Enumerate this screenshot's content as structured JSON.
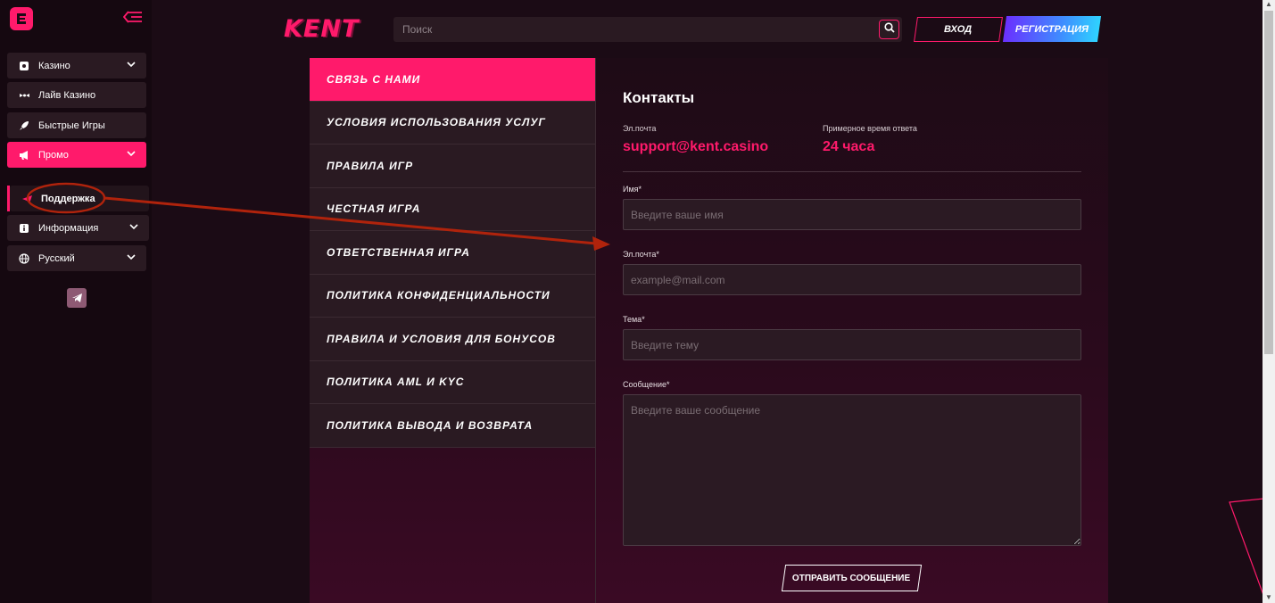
{
  "sidebar": {
    "items": [
      {
        "label": "Казино",
        "icon": "casino-icon",
        "expandable": true
      },
      {
        "label": "Лайв Казино",
        "icon": "live-casino-icon",
        "expandable": false
      },
      {
        "label": "Быстрые Игры",
        "icon": "rocket-icon",
        "expandable": false
      },
      {
        "label": "Промо",
        "icon": "megaphone-icon",
        "expandable": true,
        "active": true
      },
      {
        "label": "Поддержка",
        "icon": "support-icon",
        "expandable": false,
        "current": true
      },
      {
        "label": "Информация",
        "icon": "info-icon",
        "expandable": true
      },
      {
        "label": "Русский",
        "icon": "globe-icon",
        "expandable": true
      }
    ]
  },
  "header": {
    "brand": "KENT",
    "search_placeholder": "Поиск",
    "login_label": "ВХОД",
    "register_label": "РЕГИСТРАЦИЯ"
  },
  "menu": {
    "items": [
      "СВЯЗЬ С НАМИ",
      "УСЛОВИЯ ИСПОЛЬЗОВАНИЯ УСЛУГ",
      "ПРАВИЛА ИГР",
      "ЧЕСТНАЯ ИГРА",
      "ОТВЕТСТВЕННАЯ ИГРА",
      "ПОЛИТИКА КОНФИДЕНЦИАЛЬНОСТИ",
      "ПРАВИЛА И УСЛОВИЯ ДЛЯ БОНУСОВ",
      "ПОЛИТИКА AML И KYC",
      "ПОЛИТИКА ВЫВОДА И ВОЗВРАТА"
    ],
    "active_index": 0
  },
  "contacts": {
    "title": "Контакты",
    "email_label": "Эл.почта",
    "email_value": "support@kent.casino",
    "response_label": "Примерное время ответа",
    "response_value": "24 часа"
  },
  "form": {
    "name_label": "Имя",
    "name_placeholder": "Введите ваше имя",
    "email_label": "Эл.почта",
    "email_placeholder": "example@mail.com",
    "subject_label": "Тема",
    "subject_placeholder": "Введите тему",
    "message_label": "Сообщение",
    "message_placeholder": "Введите ваше сообщение",
    "required_mark": "*",
    "submit_label": "ОТПРАВИТЬ СООБЩЕНИЕ"
  },
  "colors": {
    "accent": "#ff1a6b",
    "background": "#1b0b15",
    "panel": "#2a1a22",
    "annotation": "#b0230c"
  }
}
